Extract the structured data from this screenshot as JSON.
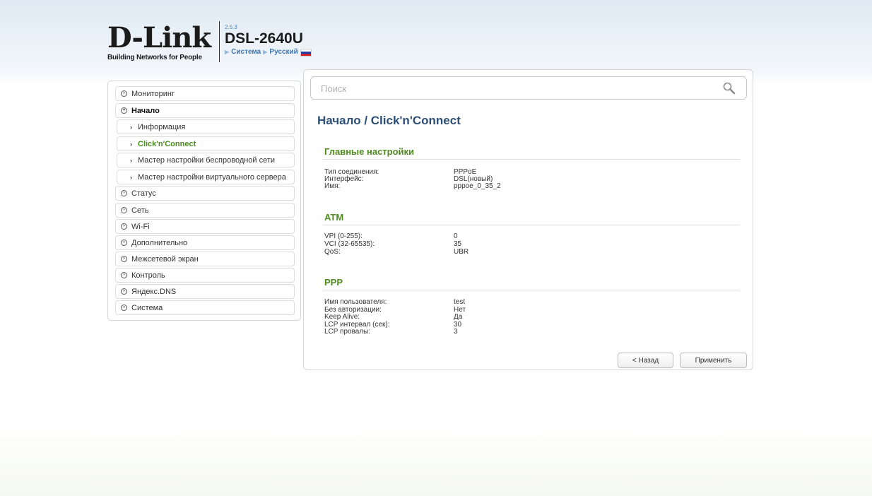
{
  "header": {
    "logo_text": "D-Link",
    "logo_reg": "R",
    "tagline": "Building Networks for People",
    "version": "2.5.3",
    "model": "DSL-2640U",
    "crumb_1": "Система",
    "crumb_2": "Русский"
  },
  "sidebar": {
    "items": [
      {
        "label": "Мониторинг"
      },
      {
        "label": "Начало"
      },
      {
        "label": "Информация"
      },
      {
        "label": "Click'n'Connect"
      },
      {
        "label": "Мастер настройки беспроводной сети"
      },
      {
        "label": "Мастер настройки виртуального сервера"
      },
      {
        "label": "Статус"
      },
      {
        "label": "Сеть"
      },
      {
        "label": "Wi-Fi"
      },
      {
        "label": "Дополнительно"
      },
      {
        "label": "Межсетевой экран"
      },
      {
        "label": "Контроль"
      },
      {
        "label": "Яндекс.DNS"
      },
      {
        "label": "Система"
      }
    ]
  },
  "search": {
    "placeholder": "Поиск"
  },
  "main": {
    "title": "Начало /  Click'n'Connect",
    "sections": [
      {
        "title": "Главные настройки",
        "rows": [
          {
            "label": "Тип соединения:",
            "value": "PPPoE"
          },
          {
            "label": "Интерфейс:",
            "value": "DSL(новый)"
          },
          {
            "label": "Имя:",
            "value": "pppoe_0_35_2"
          }
        ]
      },
      {
        "title": "ATM",
        "rows": [
          {
            "label": "VPI (0-255):",
            "value": "0"
          },
          {
            "label": "VCI (32-65535):",
            "value": "35"
          },
          {
            "label": "QoS:",
            "value": "UBR"
          }
        ]
      },
      {
        "title": "PPP",
        "rows": [
          {
            "label": "Имя пользователя:",
            "value": "test"
          },
          {
            "label": "Без авторизации:",
            "value": "Нет"
          },
          {
            "label": "Keep Alive:",
            "value": "Да"
          },
          {
            "label": "LCP интервал (сек):",
            "value": "30"
          },
          {
            "label": "LCP провалы:",
            "value": "3"
          }
        ]
      }
    ]
  },
  "buttons": {
    "back": "< Назад",
    "apply": "Применить"
  },
  "colors": {
    "accent_green": "#4f8a1e",
    "title_blue": "#2c4f78",
    "link_blue": "#3f77ad"
  }
}
